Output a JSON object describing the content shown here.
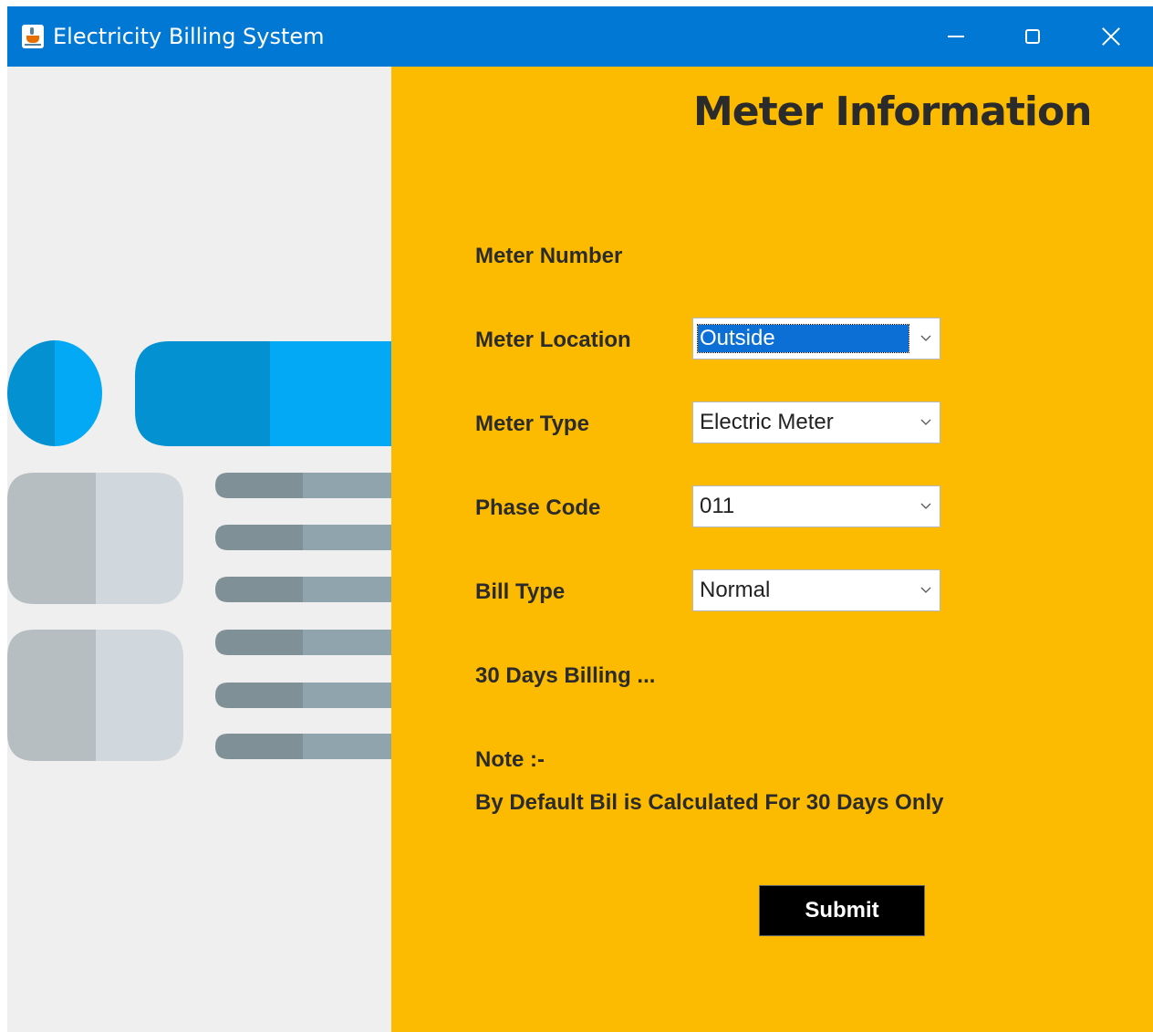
{
  "window": {
    "title": "Electricity Billing System"
  },
  "form": {
    "heading": "Meter Information",
    "meter_number_label": "Meter Number",
    "meter_location_label": "Meter Location",
    "meter_location_value": "Outside",
    "meter_type_label": "Meter Type",
    "meter_type_value": "Electric Meter",
    "phase_code_label": "Phase Code",
    "phase_code_value": "011",
    "bill_type_label": "Bill Type",
    "bill_type_value": "Normal",
    "billing_days_label": "30 Days Billing ...",
    "note_label": "Note :-",
    "note_text": "By Default Bil is Calculated For 30 Days Only",
    "submit_label": "Submit"
  },
  "colors": {
    "titlebar": "#0078d4",
    "panel_background": "#fcbb00",
    "illustration_background": "#efefef",
    "accent_blue": "#03a9f4",
    "accent_blue_dark": "#0391d1",
    "gray_light": "#d0d8de",
    "gray_mid": "#b6bec2",
    "bar_light": "#90a4ae",
    "bar_dark": "#7f9096",
    "submit_background": "#000000"
  },
  "icons": {
    "app": "java-cup-icon",
    "minimize": "minimize-icon",
    "maximize": "maximize-icon",
    "close": "close-icon",
    "dropdown": "chevron-down-icon"
  }
}
